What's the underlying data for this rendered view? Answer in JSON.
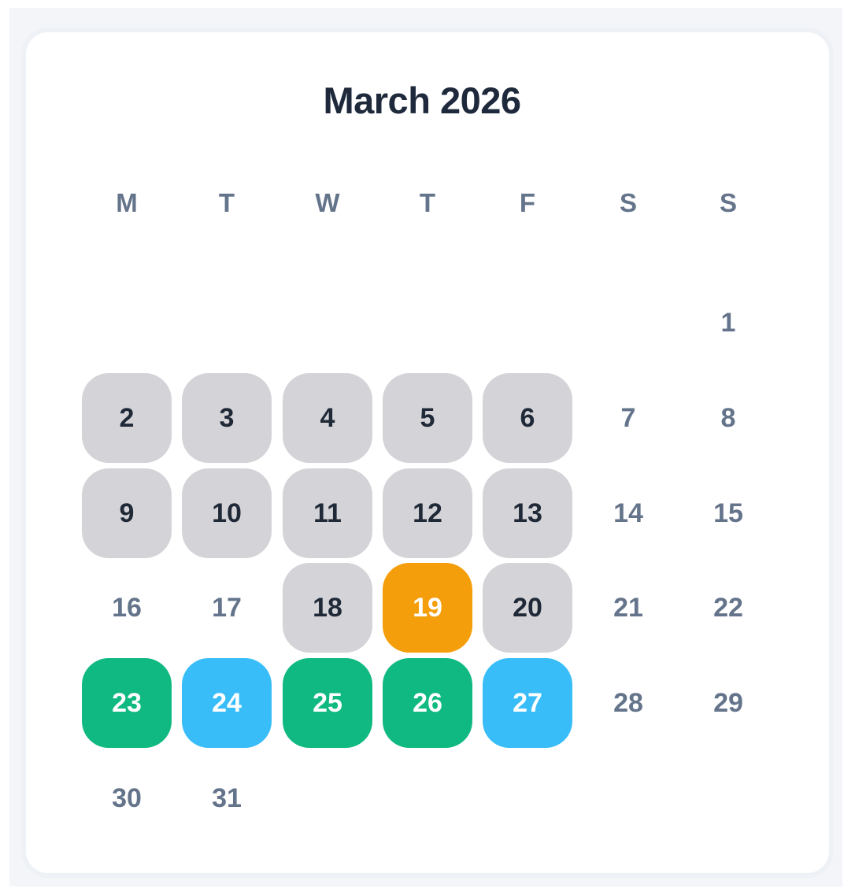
{
  "calendar": {
    "title": "March 2026",
    "weekdays": [
      "M",
      "T",
      "W",
      "T",
      "F",
      "S",
      "S"
    ],
    "colors": {
      "busy": "#d4d4d8",
      "today": "#f59e0b",
      "green": "#10b981",
      "blue": "#38bdf8",
      "plain_text": "#64748b"
    },
    "days": [
      {
        "label": "1",
        "col": 6,
        "week": 0,
        "status": "plain"
      },
      {
        "label": "2",
        "col": 0,
        "week": 1,
        "status": "busy"
      },
      {
        "label": "3",
        "col": 1,
        "week": 1,
        "status": "busy"
      },
      {
        "label": "4",
        "col": 2,
        "week": 1,
        "status": "busy"
      },
      {
        "label": "5",
        "col": 3,
        "week": 1,
        "status": "busy"
      },
      {
        "label": "6",
        "col": 4,
        "week": 1,
        "status": "busy"
      },
      {
        "label": "7",
        "col": 5,
        "week": 1,
        "status": "plain"
      },
      {
        "label": "8",
        "col": 6,
        "week": 1,
        "status": "plain"
      },
      {
        "label": "9",
        "col": 0,
        "week": 2,
        "status": "busy"
      },
      {
        "label": "10",
        "col": 1,
        "week": 2,
        "status": "busy"
      },
      {
        "label": "11",
        "col": 2,
        "week": 2,
        "status": "busy"
      },
      {
        "label": "12",
        "col": 3,
        "week": 2,
        "status": "busy"
      },
      {
        "label": "13",
        "col": 4,
        "week": 2,
        "status": "busy"
      },
      {
        "label": "14",
        "col": 5,
        "week": 2,
        "status": "plain"
      },
      {
        "label": "15",
        "col": 6,
        "week": 2,
        "status": "plain"
      },
      {
        "label": "16",
        "col": 0,
        "week": 3,
        "status": "plain"
      },
      {
        "label": "17",
        "col": 1,
        "week": 3,
        "status": "plain"
      },
      {
        "label": "18",
        "col": 2,
        "week": 3,
        "status": "busy"
      },
      {
        "label": "19",
        "col": 3,
        "week": 3,
        "status": "today"
      },
      {
        "label": "20",
        "col": 4,
        "week": 3,
        "status": "busy"
      },
      {
        "label": "21",
        "col": 5,
        "week": 3,
        "status": "plain"
      },
      {
        "label": "22",
        "col": 6,
        "week": 3,
        "status": "plain"
      },
      {
        "label": "23",
        "col": 0,
        "week": 4,
        "status": "green"
      },
      {
        "label": "24",
        "col": 1,
        "week": 4,
        "status": "blue"
      },
      {
        "label": "25",
        "col": 2,
        "week": 4,
        "status": "green"
      },
      {
        "label": "26",
        "col": 3,
        "week": 4,
        "status": "green"
      },
      {
        "label": "27",
        "col": 4,
        "week": 4,
        "status": "blue"
      },
      {
        "label": "28",
        "col": 5,
        "week": 4,
        "status": "plain"
      },
      {
        "label": "29",
        "col": 6,
        "week": 4,
        "status": "plain"
      },
      {
        "label": "30",
        "col": 0,
        "week": 5,
        "status": "plain"
      },
      {
        "label": "31",
        "col": 1,
        "week": 5,
        "status": "plain"
      }
    ]
  }
}
